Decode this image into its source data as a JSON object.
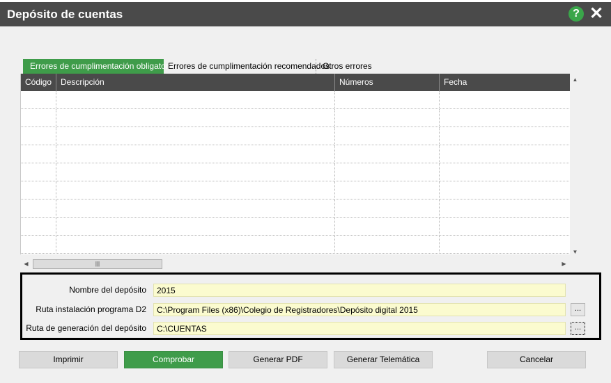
{
  "window": {
    "title": "Depósito de cuentas"
  },
  "tabs": [
    {
      "label": "Errores de cumplimentación obligatoria",
      "active": true
    },
    {
      "label": "Errores de cumplimentación recomendados",
      "active": false
    },
    {
      "label": "Otros errores",
      "active": false
    }
  ],
  "grid": {
    "columns": [
      "Código",
      "Descripción",
      "Números",
      "Fecha"
    ],
    "rows": []
  },
  "fields": {
    "deposit_name": {
      "label": "Nombre del depósito",
      "value": "2015"
    },
    "install_path": {
      "label": "Ruta instalación programa D2",
      "value": "C:\\Program Files (x86)\\Colegio de Registradores\\Depósito digital 2015"
    },
    "output_path": {
      "label": "Ruta de generación del depósito",
      "value": "C:\\CUENTAS"
    }
  },
  "browse_label": "...",
  "buttons": {
    "print": "Imprimir",
    "check": "Comprobar",
    "pdf": "Generar PDF",
    "telematic": "Generar Telemática",
    "cancel": "Cancelar"
  },
  "icons": {
    "help": "help-icon",
    "close": "close-icon",
    "scroll_up": "scroll-up-arrow-icon",
    "scroll_down": "scroll-down-arrow-icon",
    "scroll_left": "scroll-left-arrow-icon",
    "scroll_right": "scroll-right-arrow-icon"
  },
  "colors": {
    "accent": "#3f9c4a",
    "header": "#4a4a4a",
    "field": "#fbfbcf"
  }
}
